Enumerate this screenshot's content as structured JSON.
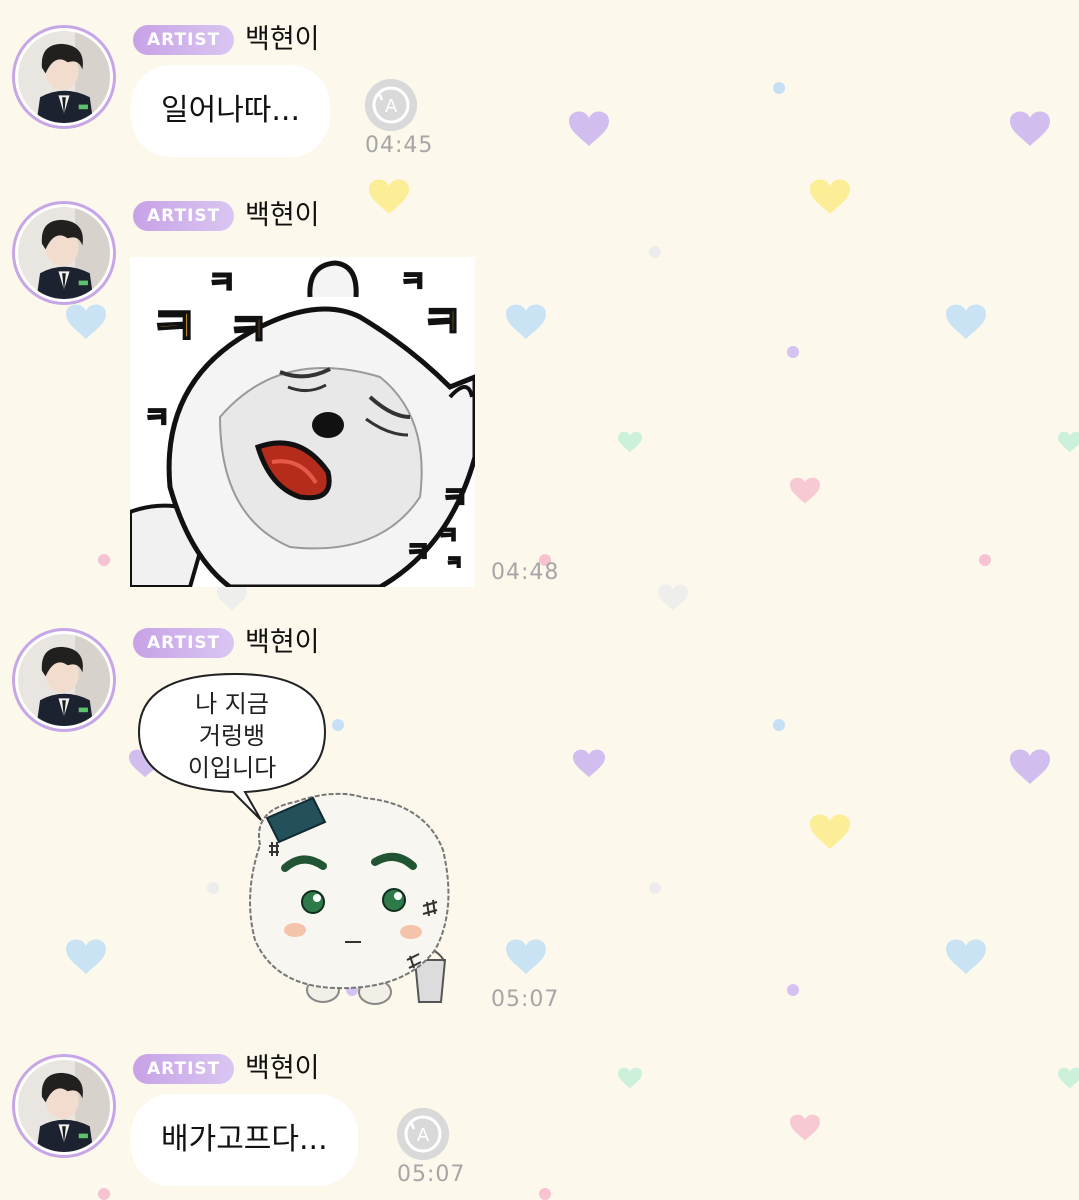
{
  "messages": [
    {
      "badge": "ARTIST",
      "sender": "백현이",
      "text": "일어나따...",
      "time": "04:45"
    },
    {
      "badge": "ARTIST",
      "sender": "백현이",
      "sticker": "laughing-bear",
      "sticker_text": [
        "ㅋ",
        "ㅋ",
        "ㅋ",
        "ㅋ",
        "ㅋ",
        "ㅋ",
        "ㅋ",
        "ㅋ",
        "ㅋ",
        "ㅋ"
      ],
      "time": "04:48"
    },
    {
      "badge": "ARTIST",
      "sender": "백현이",
      "sticker": "rice-ball",
      "sticker_text": [
        "나 지금",
        "거렁뱅",
        "이입니다"
      ],
      "time": "05:07"
    },
    {
      "badge": "ARTIST",
      "sender": "백현이",
      "text": "배가고프다...",
      "time": "05:07"
    }
  ],
  "translate_icon_letter": "A",
  "colors": {
    "background": "#fdf8ec",
    "badge": "#c7a2e6",
    "bubble": "#ffffff",
    "time": "#a6a6a6"
  }
}
